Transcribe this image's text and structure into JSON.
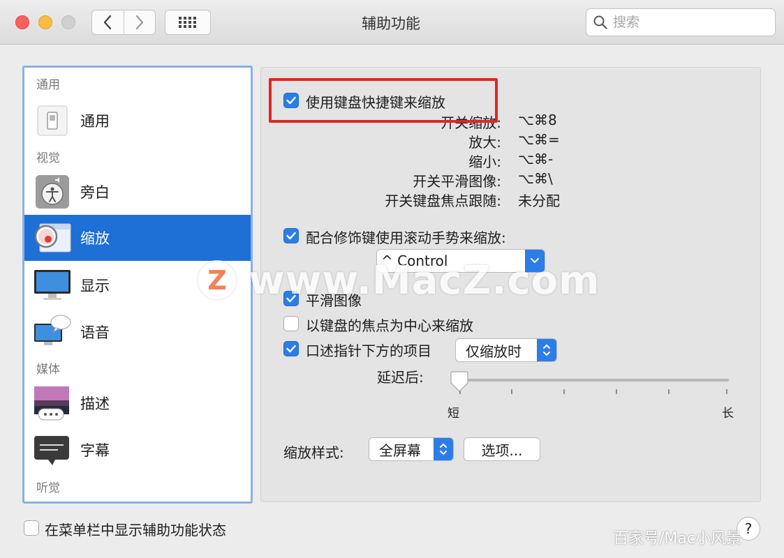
{
  "window": {
    "title": "辅助功能"
  },
  "search": {
    "placeholder": "搜索"
  },
  "sidebar": {
    "sections": [
      "通用",
      "视觉",
      "媒体",
      "听觉"
    ],
    "items": [
      {
        "label": "通用",
        "icon": "general-switch-icon"
      },
      {
        "label": "旁白",
        "icon": "voiceover-icon"
      },
      {
        "label": "缩放",
        "icon": "zoom-icon",
        "selected": true
      },
      {
        "label": "显示",
        "icon": "display-icon"
      },
      {
        "label": "语音",
        "icon": "speech-icon"
      },
      {
        "label": "描述",
        "icon": "descriptions-icon"
      },
      {
        "label": "字幕",
        "icon": "captions-icon"
      }
    ]
  },
  "zoom": {
    "keyboard_shortcuts": {
      "label": "使用键盘快捷键来缩放",
      "checked": true
    },
    "shortcuts": [
      {
        "label": "开关缩放:",
        "key": "⌥⌘8"
      },
      {
        "label": "放大:",
        "key": "⌥⌘="
      },
      {
        "label": "缩小:",
        "key": "⌥⌘-"
      },
      {
        "label": "开关平滑图像:",
        "key": "⌥⌘\\"
      },
      {
        "label": "开关键盘焦点跟随:",
        "key": "未分配"
      }
    ],
    "scroll_gesture": {
      "label": "配合修饰键使用滚动手势来缩放:",
      "checked": true,
      "modifier": "^ Control"
    },
    "smooth_images": {
      "label": "平滑图像",
      "checked": true
    },
    "keyboard_focus": {
      "label": "以键盘的焦点为中心来缩放",
      "checked": false
    },
    "speak_pointer": {
      "label": "口述指针下方的项目",
      "checked": true,
      "mode": "仅缩放时"
    },
    "delay": {
      "label": "延迟后:",
      "min_label": "短",
      "max_label": "长",
      "value": 0
    },
    "style": {
      "label": "缩放样式:",
      "value": "全屏幕",
      "options_button": "选项..."
    }
  },
  "footer": {
    "menu_bar_status": {
      "label": "在菜单栏中显示辅助功能状态",
      "checked": false
    },
    "help": "?"
  },
  "watermark": {
    "logo_letter": "Z",
    "url": "www.MacZ.com"
  },
  "credit": "百家号/Mac小风景",
  "colors": {
    "accent": "#2d7de6",
    "selection": "#1e6fd6",
    "highlight_box": "#e22626"
  }
}
